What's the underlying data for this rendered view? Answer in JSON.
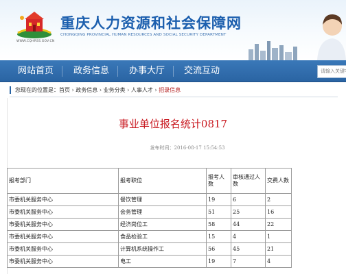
{
  "header": {
    "title": "重庆人力资源和社会保障网",
    "subtitle": "CHONGQING PROVINCIAL HUMAN RESOURCES AND SOCIAL SECURITY DEPARTMENT",
    "domain": "WWW.CQHRSS.GOV.CN",
    "brand_color": "#1c5fae"
  },
  "nav": {
    "items": [
      {
        "label": "网站首页"
      },
      {
        "label": "政务信息"
      },
      {
        "label": "办事大厅"
      },
      {
        "label": "交流互动"
      }
    ],
    "search_placeholder": "请输入关键字",
    "bg_color": "#2a64a3"
  },
  "breadcrumb": {
    "prefix": "您现在的位置是：",
    "items": [
      "首页",
      "政务信息",
      "业务分类",
      "人事人才"
    ],
    "separator": " › ",
    "current": "招录信息"
  },
  "article": {
    "title": "事业单位报名统计0817",
    "publish_time": "发布时间：2016-08-17 15:54:53",
    "title_color": "#c8161d"
  },
  "table": {
    "headers": [
      "报考部门",
      "报考职位",
      "报考人数",
      "审核通过人数",
      "交费人数"
    ],
    "rows": [
      [
        "市委机关服务中心",
        "餐饮管理",
        "19",
        "6",
        "2"
      ],
      [
        "市委机关服务中心",
        "会务管理",
        "51",
        "25",
        "16"
      ],
      [
        "市委机关服务中心",
        "经济岗位工",
        "58",
        "44",
        "22"
      ],
      [
        "市委机关服务中心",
        "食品检验工",
        "15",
        "4",
        "1"
      ],
      [
        "市委机关服务中心",
        "计算机系统操作工",
        "56",
        "45",
        "21"
      ],
      [
        "市委机关服务中心",
        "电工",
        "19",
        "7",
        "4"
      ]
    ]
  }
}
